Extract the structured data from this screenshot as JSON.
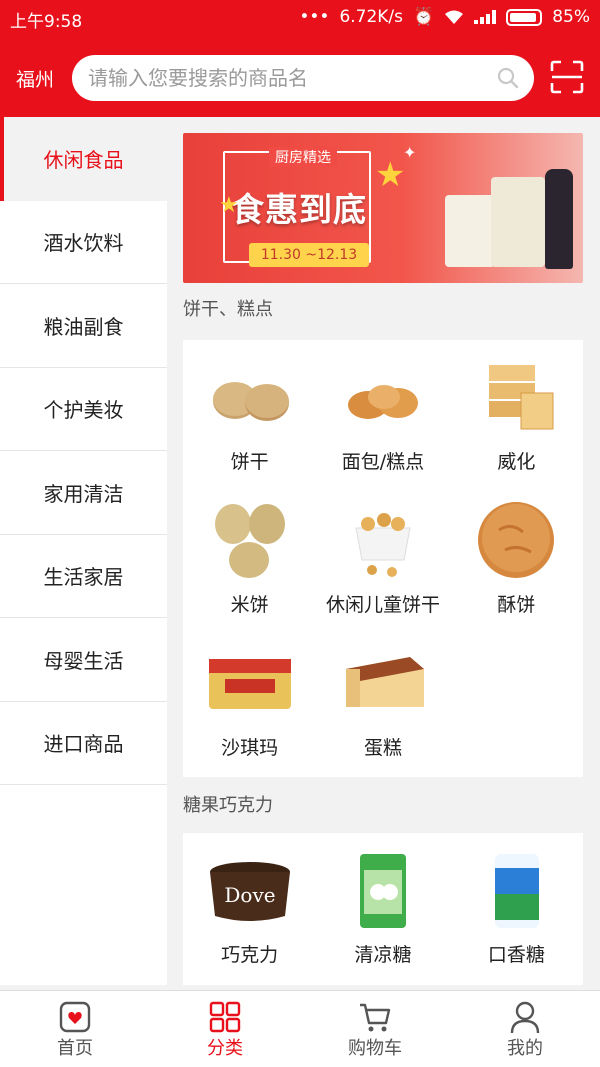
{
  "status_bar": {
    "time": "上午9:58",
    "network_speed": "6.72K/s",
    "battery": "85%"
  },
  "header": {
    "city": "福州",
    "search_placeholder": "请输入您要搜索的商品名"
  },
  "sidebar": {
    "items": [
      {
        "label": "休闲食品",
        "active": true
      },
      {
        "label": "酒水饮料"
      },
      {
        "label": "粮油副食"
      },
      {
        "label": "个护美妆"
      },
      {
        "label": "家用清洁"
      },
      {
        "label": "生活家居"
      },
      {
        "label": "母婴生活"
      },
      {
        "label": "进口商品"
      }
    ]
  },
  "banner": {
    "tag": "厨房精选",
    "headline": "食惠到底",
    "date_range": "11.30 ~12.13"
  },
  "sections": [
    {
      "title": "饼干、糕点",
      "items": [
        {
          "label": "饼干",
          "icon": "biscuit-icon"
        },
        {
          "label": "面包/糕点",
          "icon": "bread-icon"
        },
        {
          "label": "威化",
          "icon": "wafer-icon"
        },
        {
          "label": "米饼",
          "icon": "rice-cracker-icon"
        },
        {
          "label": "休闲儿童饼干",
          "icon": "kids-cookie-icon"
        },
        {
          "label": "酥饼",
          "icon": "shortbread-icon"
        },
        {
          "label": "沙琪玛",
          "icon": "sachima-icon"
        },
        {
          "label": "蛋糕",
          "icon": "cake-icon"
        }
      ]
    },
    {
      "title": "糖果巧克力",
      "items": [
        {
          "label": "巧克力",
          "icon": "chocolate-icon"
        },
        {
          "label": "清凉糖",
          "icon": "mint-candy-icon"
        },
        {
          "label": "口香糖",
          "icon": "gum-icon"
        }
      ]
    }
  ],
  "tabbar": {
    "items": [
      {
        "label": "首页",
        "icon": "home-icon"
      },
      {
        "label": "分类",
        "icon": "category-icon",
        "active": true
      },
      {
        "label": "购物车",
        "icon": "cart-icon"
      },
      {
        "label": "我的",
        "icon": "profile-icon"
      }
    ]
  },
  "colors": {
    "brand": "#e8111b",
    "page_bg": "#f2f2f2"
  }
}
